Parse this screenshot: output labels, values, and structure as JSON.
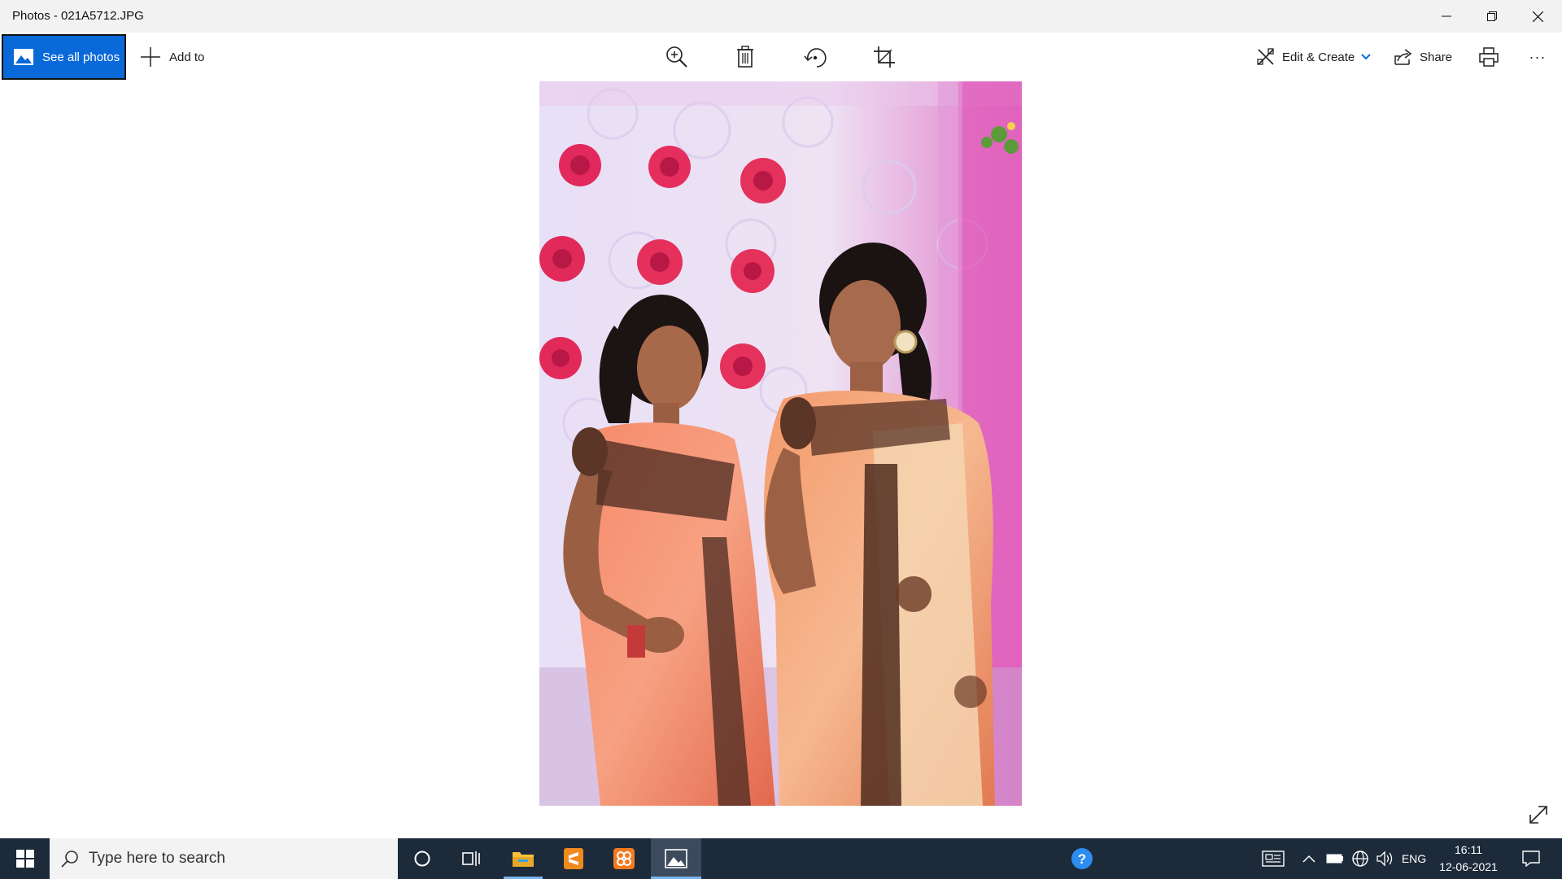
{
  "window": {
    "title": "Photos - 021A5712.JPG",
    "controls": [
      "minimize-icon",
      "restore-icon",
      "close-icon"
    ]
  },
  "toolbar": {
    "see_all_label": "See all photos",
    "add_to_label": "Add to",
    "center_tools": [
      "zoom-in-icon",
      "delete-icon",
      "rotate-icon",
      "crop-icon"
    ],
    "edit_create_label": "Edit & Create",
    "share_label": "Share",
    "more_label": "···"
  },
  "taskbar": {
    "search_placeholder": "Type here to search",
    "language": "ENG",
    "time": "16:11",
    "date": "12-06-2021"
  },
  "colors": {
    "accent": "#0a69d9",
    "taskbar": "#1c2a3a"
  }
}
